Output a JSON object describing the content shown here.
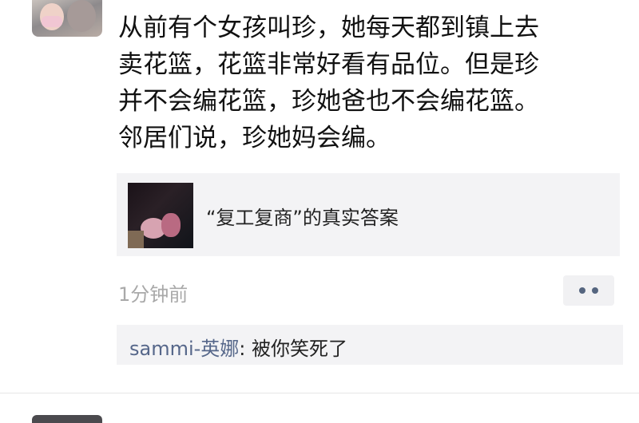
{
  "post": {
    "text": "从前有个女孩叫珍，她每天都到镇上去\n卖花篮，花篮非常好看有品位。但是珍\n并不会编花篮，珍她爸也不会编花篮。\n邻居们说，珍她妈会编。"
  },
  "share_card": {
    "title": "“复工复商”的真实答案"
  },
  "meta": {
    "time": "1分钟前"
  },
  "comment": {
    "user": "sammi-英娜",
    "separator": ": ",
    "text": "被你笑死了"
  },
  "icons": {
    "more": "more-dots-icon"
  }
}
